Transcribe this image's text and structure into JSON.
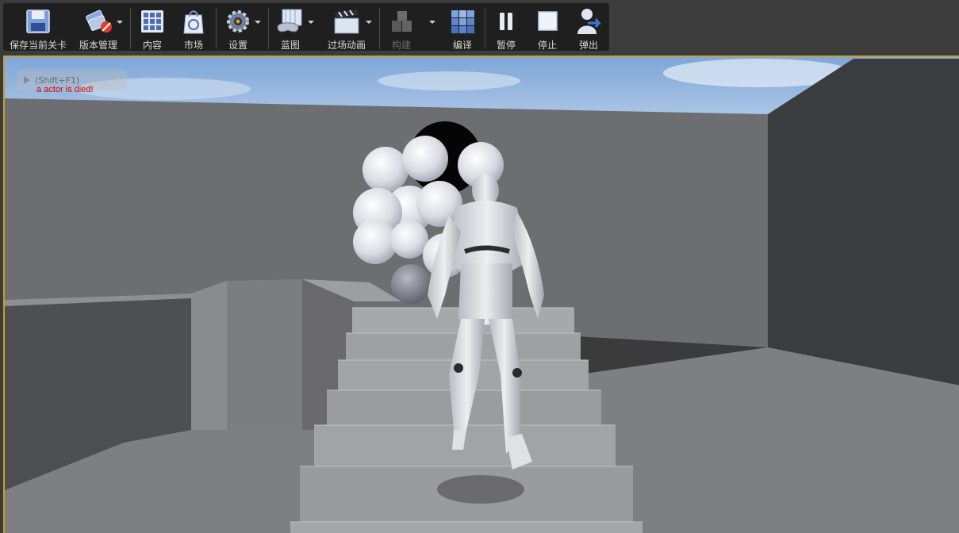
{
  "toolbar": {
    "save_level": "保存当前关卡",
    "source_control": "版本管理",
    "content": "内容",
    "marketplace": "市场",
    "settings": "设置",
    "blueprints": "蓝图",
    "cinematics": "过场动画",
    "build": "构建",
    "compile": "编译",
    "pause": "暂停",
    "stop": "停止",
    "eject": "弹出"
  },
  "viewport": {
    "overlay_hint": "(Shift+F1)",
    "debug_message": "a actor is died!",
    "accent_color": "#c9a227",
    "debug_color": "#d40000"
  }
}
